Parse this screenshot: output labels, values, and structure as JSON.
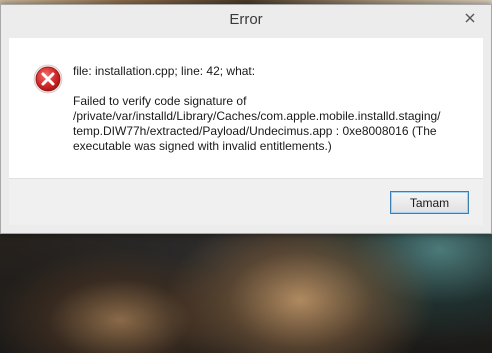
{
  "window": {
    "title": "Error"
  },
  "message": {
    "line1": "file: installation.cpp; line: 42; what:",
    "line2": "Failed to verify code signature of\n/private/var/installd/Library/Caches/com.apple.mobile.installd.staging/\ntemp.DIW77h/extracted/Payload/Undecimus.app : 0xe8008016 (The\nexecutable was signed with invalid entitlements.)"
  },
  "buttons": {
    "ok_label": "Tamam"
  },
  "icons": {
    "error": "error-x-icon",
    "close": "close-icon"
  },
  "colors": {
    "error_red": "#d42a2a",
    "button_focus_border": "#3c7fb1"
  }
}
